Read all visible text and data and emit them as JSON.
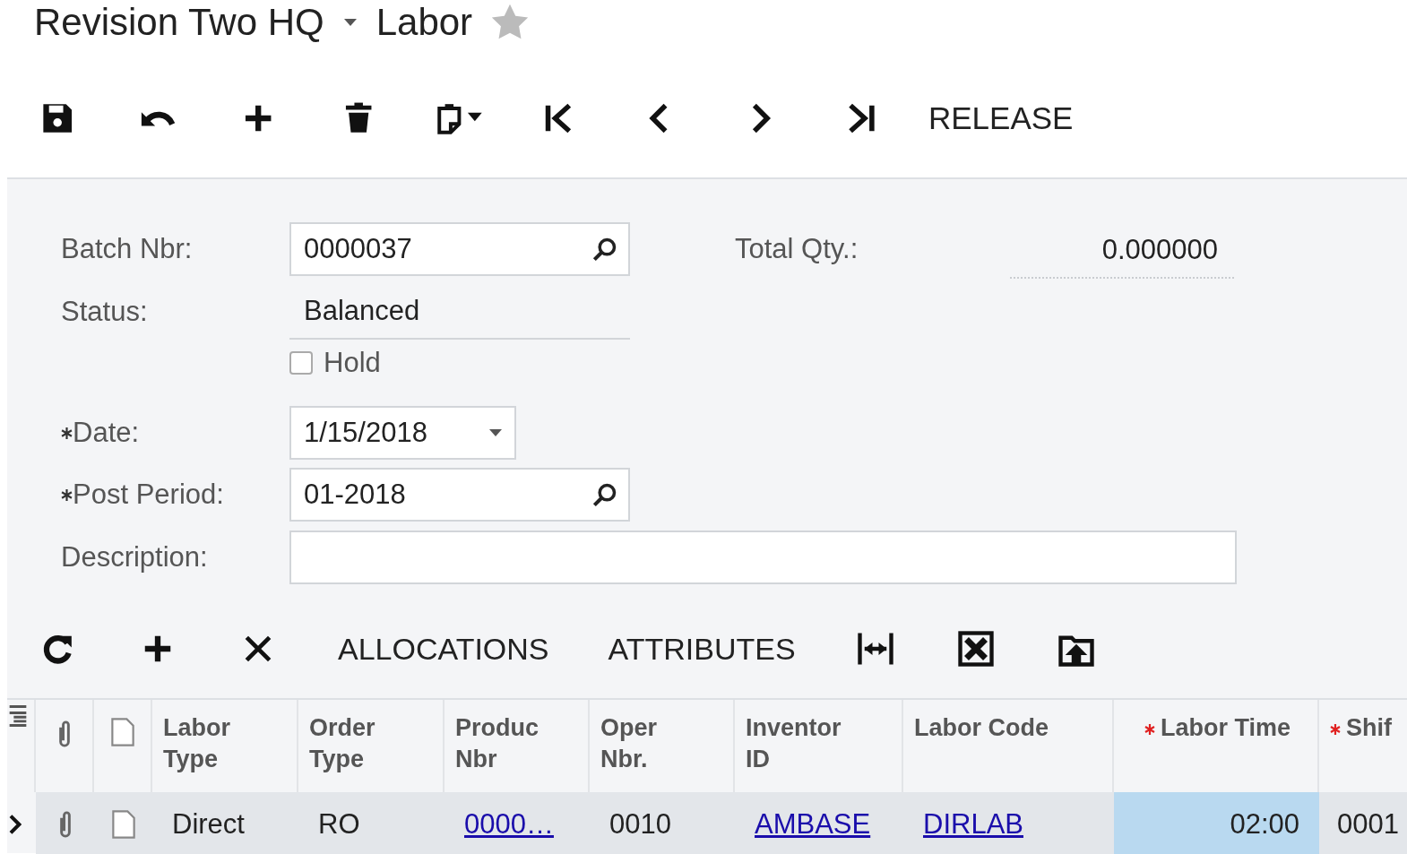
{
  "breadcrumb": {
    "company": "Revision Two HQ",
    "screen": "Labor",
    "favorite": false
  },
  "toolbar": {
    "actions": [
      "RELEASE"
    ]
  },
  "form": {
    "batch_nbr": {
      "label": "Batch Nbr:",
      "value": "0000037"
    },
    "status": {
      "label": "Status:",
      "value": "Balanced"
    },
    "hold": {
      "label": "Hold",
      "checked": false
    },
    "date": {
      "label": "Date:",
      "value": "1/15/2018",
      "required": true
    },
    "post_period": {
      "label": "Post Period:",
      "value": "01-2018",
      "required": true
    },
    "description": {
      "label": "Description:"
    },
    "total_qty": {
      "label": "Total Qty.:",
      "value": "0.000000"
    }
  },
  "grid_toolbar": {
    "actions": [
      "ALLOCATIONS",
      "ATTRIBUTES"
    ]
  },
  "grid": {
    "columns": [
      {
        "label": "Labor Type",
        "required": false
      },
      {
        "label": "Order Type",
        "required": false
      },
      {
        "label": "Produc Nbr",
        "required": false
      },
      {
        "label": "Oper Nbr.",
        "required": false
      },
      {
        "label": "Inventor ID",
        "required": false
      },
      {
        "label": "Labor Code",
        "required": false
      },
      {
        "label": "Labor Time",
        "required": true
      },
      {
        "label": "Shif",
        "required": true
      }
    ],
    "rows": [
      {
        "selected": true,
        "cells": [
          {
            "text": "Direct",
            "link": false,
            "active": false
          },
          {
            "text": "RO",
            "link": false,
            "active": false
          },
          {
            "text": "0000…",
            "link": true,
            "active": false
          },
          {
            "text": "0010",
            "link": false,
            "active": false
          },
          {
            "text": "AMBASE",
            "link": true,
            "active": false
          },
          {
            "text": "DIRLAB",
            "link": true,
            "active": false
          },
          {
            "text": "02:00",
            "link": false,
            "active": true
          },
          {
            "text": "0001",
            "link": false,
            "active": false
          }
        ]
      }
    ]
  }
}
